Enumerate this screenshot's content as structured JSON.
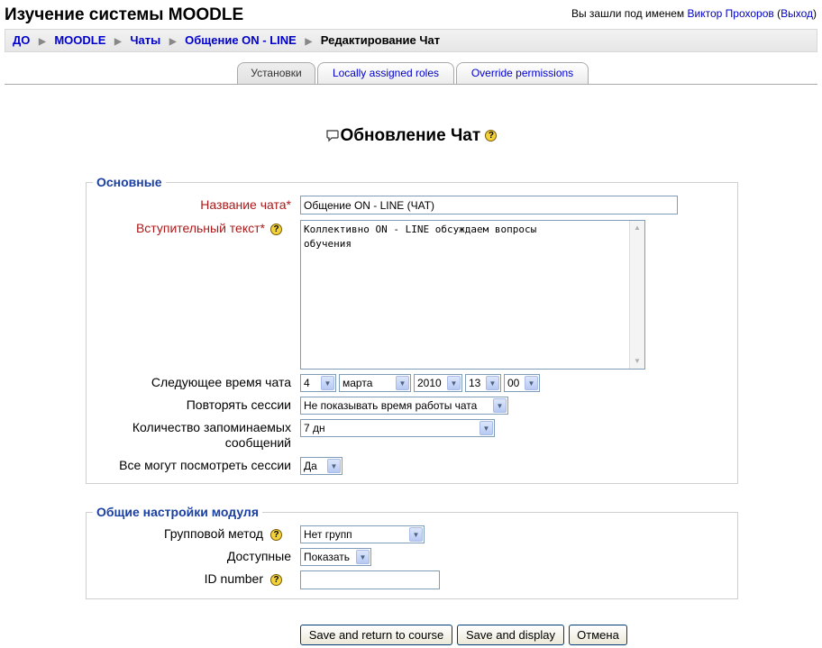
{
  "header": {
    "site_title": "Изучение системы MOODLE",
    "login_prefix": "Вы зашли под именем",
    "user_name": "Виктор Прохоров",
    "logout_label": "Выход"
  },
  "breadcrumb": {
    "items": [
      "ДО",
      "MOODLE",
      "Чаты",
      "Общение ON - LINE"
    ],
    "current": "Редактирование Чат"
  },
  "tabs": [
    {
      "label": "Установки",
      "active": true
    },
    {
      "label": "Locally assigned roles",
      "active": false
    },
    {
      "label": "Override permissions",
      "active": false
    }
  ],
  "page_heading": "Обновление Чат",
  "sections": {
    "general": {
      "legend": "Основные",
      "name_label": "Название чата*",
      "name_value": "Общение ON - LINE (ЧАТ)",
      "intro_label": "Вступительный текст*",
      "intro_value": "Коллективно ON - LINE обсуждаем вопросы\nобучения",
      "next_time_label": "Следующее время чата",
      "next_time": {
        "day": "4",
        "month": "марта",
        "year": "2010",
        "hour": "13",
        "minute": "00"
      },
      "repeat_label": "Повторять сессии",
      "repeat_value": "Не показывать время работы чата",
      "keep_label_line1": "Количество запоминаемых",
      "keep_label_line2": "сообщений",
      "keep_value": "7 дн",
      "view_sessions_label": "Все могут посмотреть сессии",
      "view_sessions_value": "Да"
    },
    "common": {
      "legend": "Общие настройки модуля",
      "group_mode_label": "Групповой метод",
      "group_mode_value": "Нет групп",
      "visible_label": "Доступные",
      "visible_value": "Показать",
      "idnumber_label": "ID number",
      "idnumber_value": ""
    }
  },
  "buttons": {
    "save_return": "Save and return to course",
    "save_display": "Save and display",
    "cancel": "Отмена"
  },
  "icons": {
    "help": "help-icon",
    "chat": "chat-icon",
    "breadcrumb_separator": "arrow-right-icon",
    "dropdown": "chevron-down-icon"
  },
  "colors": {
    "link": "#0000cc",
    "required_label": "#aa1a1a",
    "legend": "#1a3fa3",
    "help_icon": "#f4d23a"
  }
}
